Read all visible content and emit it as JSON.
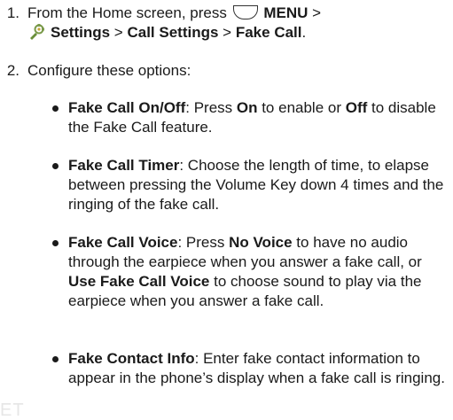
{
  "steps": [
    {
      "number": "1.",
      "parts": {
        "from": "From the Home screen, press",
        "menu_icon": "menu-key-icon",
        "menu": "MENU",
        "sep1": ">",
        "settings_icon": "settings-icon",
        "settings": "Settings",
        "sep2": ">",
        "call_settings": "Call Settings",
        "sep3": ">",
        "fake_call": "Fake Call",
        "period": "."
      }
    },
    {
      "number": "2.",
      "text": "Configure these options:"
    }
  ],
  "options": [
    {
      "term": "Fake Call On/Off",
      "segments": [
        {
          "text": ": Press ",
          "bold": false
        },
        {
          "text": "On",
          "bold": true
        },
        {
          "text": " to enable or ",
          "bold": false
        },
        {
          "text": "Off",
          "bold": true
        },
        {
          "text": " to disable the Fake Call feature.",
          "bold": false
        }
      ]
    },
    {
      "term": "Fake Call Timer",
      "segments": [
        {
          "text": ": Choose the length of time, to elapse between pressing the Volume Key down 4 times and the ringing of the fake call.",
          "bold": false
        }
      ]
    },
    {
      "term": "Fake Call Voice",
      "segments": [
        {
          "text": ": Press ",
          "bold": false
        },
        {
          "text": "No Voice",
          "bold": true
        },
        {
          "text": " to have no audio through the earpiece when you answer a fake call, or ",
          "bold": false
        },
        {
          "text": "Use Fake Call Voice",
          "bold": true
        },
        {
          "text": " to choose sound to play via the earpiece when you answer a fake call.",
          "bold": false
        }
      ]
    },
    {
      "term": "Fake Contact Info",
      "segments": [
        {
          "text": ": Enter fake contact information to appear in the phone’s display when a fake call is ringing.",
          "bold": false
        }
      ]
    }
  ],
  "watermark": "ET"
}
